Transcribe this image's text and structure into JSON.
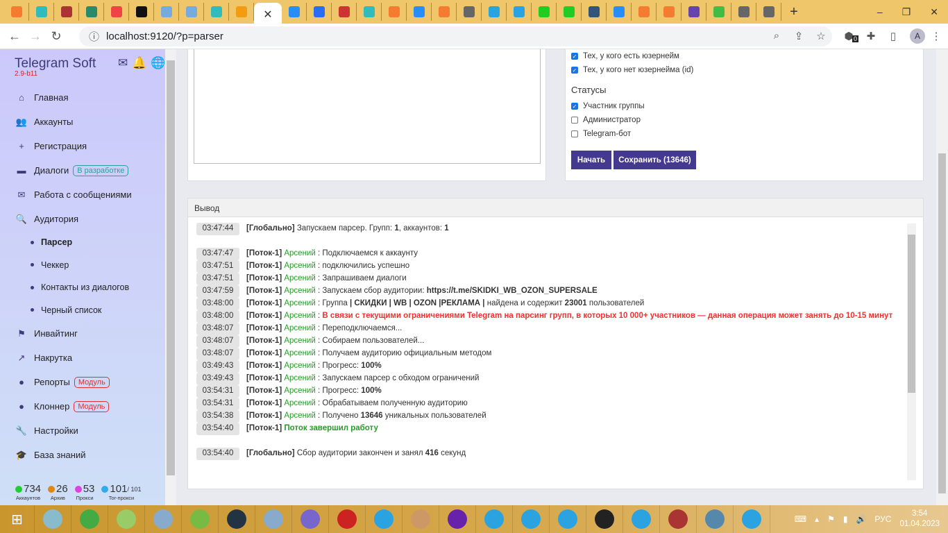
{
  "browser": {
    "url": "localhost:9120/?p=parser",
    "tab_close": "✕",
    "new_tab": "+",
    "profile_initial": "A",
    "extension_badge": "0"
  },
  "tab_colors": [
    "#f47b30",
    "#3bb",
    "#a33",
    "#2a8a6a",
    "#e44",
    "#111",
    "#7ad",
    "#7ad",
    "#3bb",
    "#f39c12",
    "#666",
    "#2a8cf7",
    "#2a6df4",
    "#c33",
    "#3bb",
    "#f47b30",
    "#2a8cf7",
    "#f47b30",
    "#666",
    "#2aa3e0",
    "#2aa3e0",
    "#2c2",
    "#2c2",
    "#357",
    "#2a8cf7",
    "#f47b30",
    "#f47b30",
    "#64a",
    "#4b4",
    "#666",
    "#666"
  ],
  "sidebar": {
    "brand": "Telegram Soft",
    "version": "2.9-b11",
    "items": [
      {
        "label": "Главная",
        "icon": "⌂",
        "name": "home"
      },
      {
        "label": "Аккаунты",
        "icon": "👥",
        "name": "accounts"
      },
      {
        "label": "Регистрация",
        "icon": "+",
        "name": "registration"
      },
      {
        "label": "Диалоги",
        "icon": "▬",
        "name": "dialogs",
        "badge": "В разработке",
        "badge_color": "#2aa198"
      },
      {
        "label": "Работа с сообщениями",
        "icon": "✉",
        "name": "messages"
      },
      {
        "label": "Аудитория",
        "icon": "🔍",
        "name": "audience"
      }
    ],
    "subitems": [
      {
        "label": "Парсер",
        "active": true
      },
      {
        "label": "Чеккер"
      },
      {
        "label": "Контакты из диалогов"
      },
      {
        "label": "Черный список"
      }
    ],
    "items2": [
      {
        "label": "Инвайтинг",
        "icon": "⚑",
        "name": "inviting"
      },
      {
        "label": "Накрутка",
        "icon": "↗",
        "name": "boost"
      },
      {
        "label": "Репорты",
        "icon": "●",
        "name": "reports",
        "badge": "Модуль",
        "badge_color": "#e03030"
      },
      {
        "label": "Клоннер",
        "icon": "●",
        "name": "cloner",
        "badge": "Модуль",
        "badge_color": "#e03030"
      },
      {
        "label": "Настройки",
        "icon": "🔧",
        "name": "settings"
      },
      {
        "label": "База знаний",
        "icon": "🎓",
        "name": "knowledge"
      }
    ],
    "stats": [
      {
        "value": "734",
        "label": "Аккаунтов",
        "color": "#22cc33"
      },
      {
        "value": "26",
        "label": "Архив",
        "color": "#dd8811"
      },
      {
        "value": "53",
        "label": "Прокси",
        "color": "#dd44dd"
      },
      {
        "value": "101",
        "extra": "/ 101",
        "label": "Tor-прокси",
        "color": "#33aaee"
      }
    ]
  },
  "form": {
    "checks": [
      {
        "label": "Тех, у кого есть юзернейм",
        "checked": true
      },
      {
        "label": "Тех, у кого нет юзернейма (id)",
        "checked": true
      }
    ],
    "statuses_title": "Статусы",
    "statuses": [
      {
        "label": "Участник группы",
        "checked": true
      },
      {
        "label": "Администратор",
        "checked": false
      },
      {
        "label": "Telegram-бот",
        "checked": false
      }
    ],
    "start_label": "Начать",
    "save_label": "Сохранить (13646)"
  },
  "output": {
    "title": "Вывод",
    "log": [
      {
        "time": "03:47:44",
        "parts": [
          {
            "t": "[Глобально]",
            "b": 1
          },
          {
            "t": " Запускаем парсер. Групп: "
          },
          {
            "t": "1",
            "b": 1
          },
          {
            "t": ", аккаунтов: "
          },
          {
            "t": "1",
            "b": 1
          }
        ]
      },
      {
        "gap": true
      },
      {
        "time": "03:47:47",
        "parts": [
          {
            "t": "[Поток-1]",
            "b": 1
          },
          {
            "t": " Арсений",
            "c": "#2a9a2a"
          },
          {
            "t": " : Подключаемся к аккаунту"
          }
        ]
      },
      {
        "time": "03:47:51",
        "parts": [
          {
            "t": "[Поток-1]",
            "b": 1
          },
          {
            "t": " Арсений",
            "c": "#2a9a2a"
          },
          {
            "t": " : подключились успешно"
          }
        ]
      },
      {
        "time": "03:47:51",
        "parts": [
          {
            "t": "[Поток-1]",
            "b": 1
          },
          {
            "t": " Арсений",
            "c": "#2a9a2a"
          },
          {
            "t": " : Запрашиваем диалоги"
          }
        ]
      },
      {
        "time": "03:47:59",
        "parts": [
          {
            "t": "[Поток-1]",
            "b": 1
          },
          {
            "t": " Арсений",
            "c": "#2a9a2a"
          },
          {
            "t": " : Запускаем сбор аудитории: "
          },
          {
            "t": "https://t.me/SKIDKI_WB_OZON_SUPERSALE",
            "b": 1
          }
        ]
      },
      {
        "time": "03:48:00",
        "parts": [
          {
            "t": "[Поток-1]",
            "b": 1
          },
          {
            "t": " Арсений",
            "c": "#2a9a2a"
          },
          {
            "t": " : Группа "
          },
          {
            "t": "| СКИДКИ | WB | OZON |РЕКЛАМА |",
            "b": 1
          },
          {
            "t": " найдена и содержит "
          },
          {
            "t": "23001",
            "b": 1
          },
          {
            "t": " пользователей"
          }
        ]
      },
      {
        "time": "03:48:00",
        "parts": [
          {
            "t": "[Поток-1]",
            "b": 1
          },
          {
            "t": " Арсений",
            "c": "#2a9a2a"
          },
          {
            "t": " : "
          },
          {
            "t": "В связи с текущими ограничениями Telegram на парсинг групп, в которых 10 000+ участников — данная операция может занять до 10-15 минут",
            "b": 1,
            "c": "#f03030"
          }
        ]
      },
      {
        "time": "03:48:07",
        "parts": [
          {
            "t": "[Поток-1]",
            "b": 1
          },
          {
            "t": " Арсений",
            "c": "#2a9a2a"
          },
          {
            "t": " : Переподключаемся..."
          }
        ]
      },
      {
        "time": "03:48:07",
        "parts": [
          {
            "t": "[Поток-1]",
            "b": 1
          },
          {
            "t": " Арсений",
            "c": "#2a9a2a"
          },
          {
            "t": " : Собираем пользователей..."
          }
        ]
      },
      {
        "time": "03:48:07",
        "parts": [
          {
            "t": "[Поток-1]",
            "b": 1
          },
          {
            "t": " Арсений",
            "c": "#2a9a2a"
          },
          {
            "t": " : Получаем аудиторию официальным методом"
          }
        ]
      },
      {
        "time": "03:49:43",
        "parts": [
          {
            "t": "[Поток-1]",
            "b": 1
          },
          {
            "t": " Арсений",
            "c": "#2a9a2a"
          },
          {
            "t": " : Прогресс: "
          },
          {
            "t": "100%",
            "b": 1
          }
        ]
      },
      {
        "time": "03:49:43",
        "parts": [
          {
            "t": "[Поток-1]",
            "b": 1
          },
          {
            "t": " Арсений",
            "c": "#2a9a2a"
          },
          {
            "t": " : Запускаем парсер с обходом ограничений"
          }
        ]
      },
      {
        "time": "03:54:31",
        "parts": [
          {
            "t": "[Поток-1]",
            "b": 1
          },
          {
            "t": " Арсений",
            "c": "#2a9a2a"
          },
          {
            "t": " : Прогресс: "
          },
          {
            "t": "100%",
            "b": 1
          }
        ]
      },
      {
        "time": "03:54:31",
        "parts": [
          {
            "t": "[Поток-1]",
            "b": 1
          },
          {
            "t": " Арсений",
            "c": "#2a9a2a"
          },
          {
            "t": " : Обрабатываем полученную аудиторию"
          }
        ]
      },
      {
        "time": "03:54:38",
        "parts": [
          {
            "t": "[Поток-1]",
            "b": 1
          },
          {
            "t": " Арсений",
            "c": "#2a9a2a"
          },
          {
            "t": " : Получено "
          },
          {
            "t": "13646",
            "b": 1
          },
          {
            "t": " уникальных пользователей"
          }
        ]
      },
      {
        "time": "03:54:40",
        "parts": [
          {
            "t": "[Поток-1]",
            "b": 1
          },
          {
            "t": " Поток завершил работу",
            "b": 1,
            "c": "#2a9a2a"
          }
        ]
      },
      {
        "gap": true
      },
      {
        "time": "03:54:40",
        "parts": [
          {
            "t": "[Глобально]",
            "b": 1
          },
          {
            "t": " Сбор аудитории закончен и занял "
          },
          {
            "t": "416",
            "b": 1
          },
          {
            "t": " секунд"
          }
        ]
      }
    ]
  },
  "taskbar": {
    "apps": [
      "#8bc",
      "#4a4",
      "#9c6",
      "#8ac",
      "#7b4",
      "#234",
      "#8ac",
      "#76c",
      "#c22",
      "#2aa3e0",
      "#c96",
      "#62a",
      "#2aa3e0",
      "#2aa3e0",
      "#2aa3e0",
      "#222",
      "#2aa3e0",
      "#a33",
      "#58a",
      "#2aa3e0"
    ],
    "lang": "РУС",
    "time": "3:54",
    "date": "01.04.2023"
  }
}
